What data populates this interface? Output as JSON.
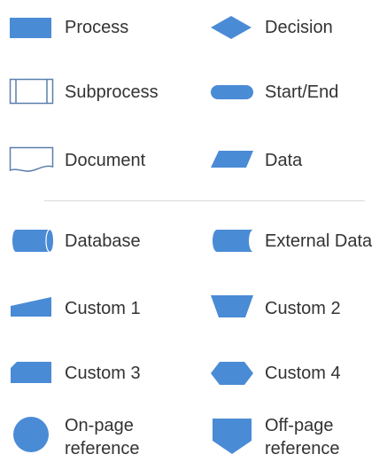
{
  "shapes": {
    "process": "Process",
    "decision": "Decision",
    "subprocess": "Subprocess",
    "start_end": "Start/End",
    "document": "Document",
    "data": "Data",
    "database": "Database",
    "external_data": "External Data",
    "custom1": "Custom 1",
    "custom2": "Custom 2",
    "custom3": "Custom 3",
    "custom4": "Custom 4",
    "on_page_reference": "On-page\nreference",
    "off_page_reference": "Off-page\nreference"
  },
  "colors": {
    "fill": "#4a8bd6",
    "outline": "#5a7fae",
    "text": "#333333",
    "divider": "#d9d9d9"
  }
}
